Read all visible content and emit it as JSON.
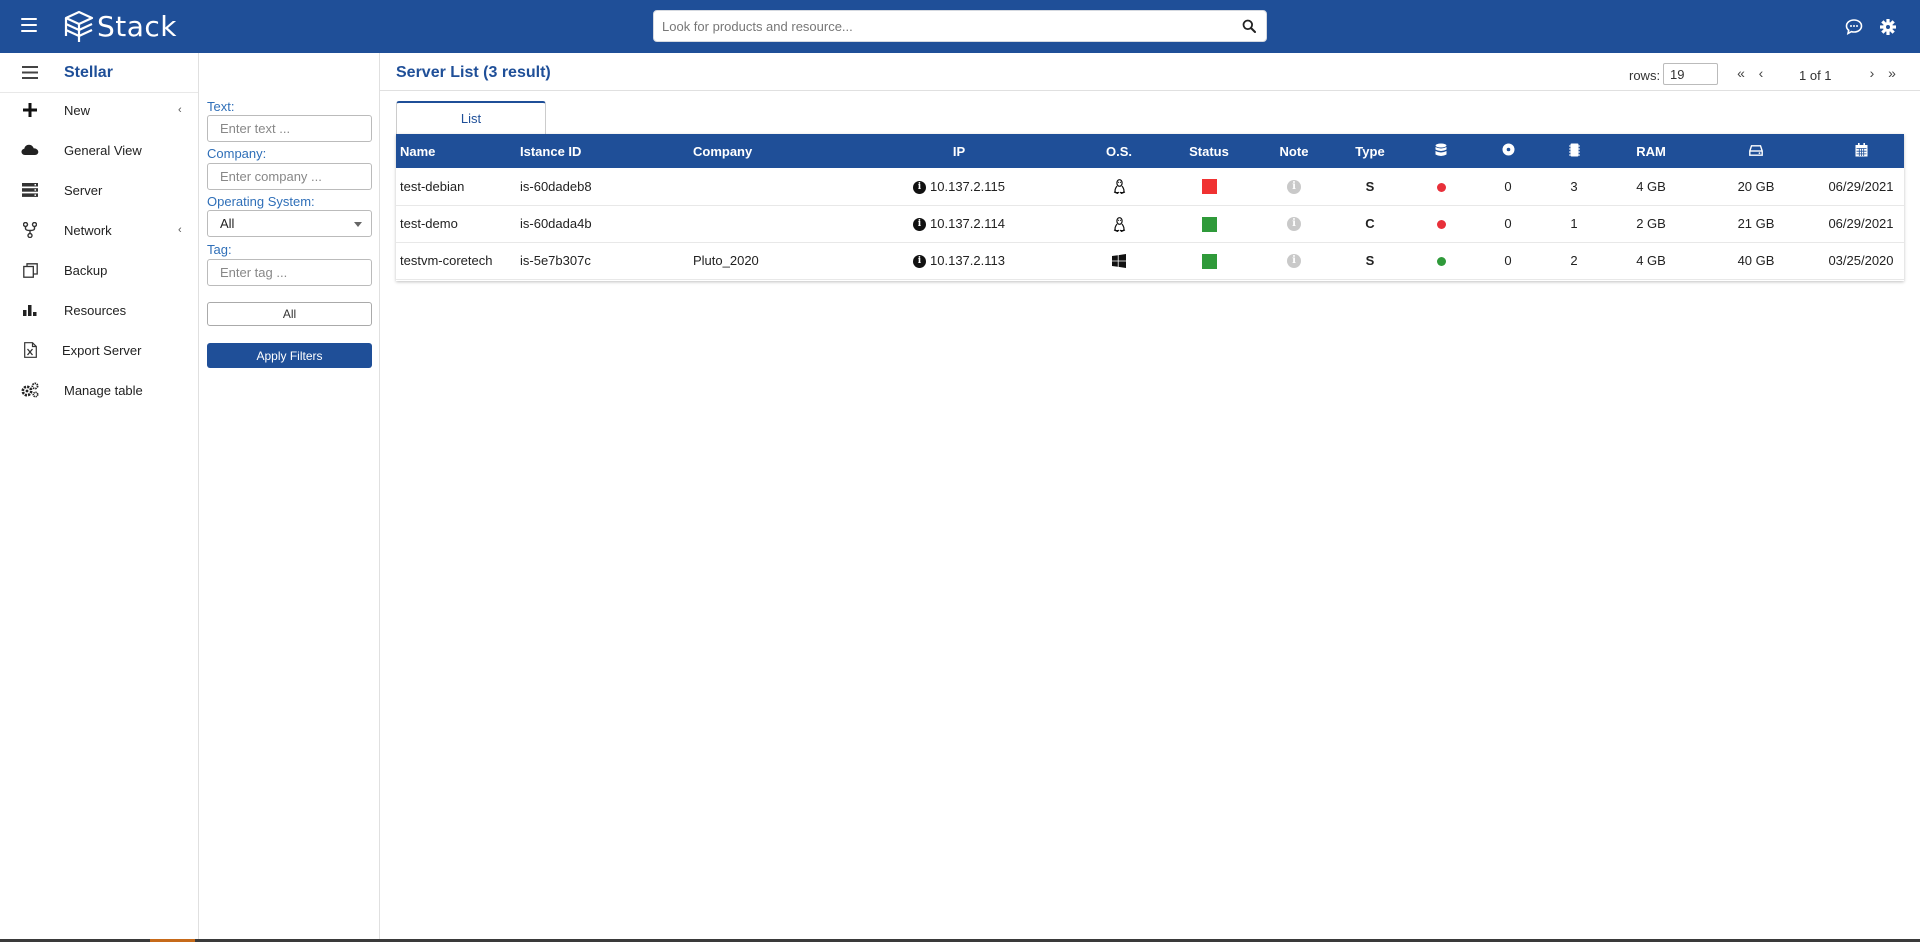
{
  "app": {
    "logo_text": "Stack",
    "search_placeholder": "Look for products and resource..."
  },
  "nav": {
    "title": "Stellar",
    "items": [
      {
        "label": "New",
        "icon": "plus-icon",
        "has_submenu": true
      },
      {
        "label": "General View",
        "icon": "cloud-icon",
        "has_submenu": false
      },
      {
        "label": "Server",
        "icon": "server-icon",
        "has_submenu": false
      },
      {
        "label": "Network",
        "icon": "network-icon",
        "has_submenu": true
      },
      {
        "label": "Backup",
        "icon": "backup-icon",
        "has_submenu": false
      },
      {
        "label": "Resources",
        "icon": "bar-chart-icon",
        "has_submenu": false
      },
      {
        "label": "Export Server",
        "icon": "excel-file-icon",
        "has_submenu": false
      },
      {
        "label": "Manage table",
        "icon": "cogs-icon",
        "has_submenu": false
      }
    ]
  },
  "filters": {
    "text_label": "Text:",
    "text_placeholder": "Enter text ...",
    "company_label": "Company:",
    "company_placeholder": "Enter company ...",
    "os_label": "Operating System:",
    "os_value": "All",
    "tag_label": "Tag:",
    "tag_placeholder": "Enter tag ...",
    "all_button": "All",
    "apply_button": "Apply Filters"
  },
  "main": {
    "title": "Server List (3 result)",
    "rows_label": "rows:",
    "rows_value": "19",
    "page_info": "1 of 1",
    "tab_label": "List"
  },
  "table": {
    "headers": [
      "Name",
      "Istance ID",
      "Company",
      "IP",
      "O.S.",
      "Status",
      "Note",
      "Type",
      "",
      "",
      "",
      "RAM",
      "",
      ""
    ],
    "header_icons": {
      "storage": "database-icon",
      "cd": "disc-icon",
      "cpu": "cpu-icon",
      "disk": "hdd-icon",
      "date": "calendar-icon"
    },
    "rows": [
      {
        "name": "test-debian",
        "instance_id": "is-60dadeb8",
        "company": "",
        "ip": "10.137.2.115",
        "os": "linux",
        "status_color": "#f03232",
        "type": "S",
        "dot_color": "#e8303a",
        "col_cd": "0",
        "col_cpu": "3",
        "ram": "4 GB",
        "disk": "20 GB",
        "date": "06/29/2021"
      },
      {
        "name": "test-demo",
        "instance_id": "is-60dada4b",
        "company": "",
        "ip": "10.137.2.114",
        "os": "linux",
        "status_color": "#2f9a3a",
        "type": "C",
        "dot_color": "#e8303a",
        "col_cd": "0",
        "col_cpu": "1",
        "ram": "2 GB",
        "disk": "21 GB",
        "date": "06/29/2021"
      },
      {
        "name": "testvm-coretech",
        "instance_id": "is-5e7b307c",
        "company": "Pluto_2020",
        "ip": "10.137.2.113",
        "os": "windows",
        "status_color": "#2f9a3a",
        "type": "S",
        "dot_color": "#2f9a3a",
        "col_cd": "0",
        "col_cpu": "2",
        "ram": "4 GB",
        "disk": "40 GB",
        "date": "03/25/2020"
      }
    ]
  },
  "colors": {
    "brand": "#1f4f98",
    "link": "#2f6fb8"
  }
}
